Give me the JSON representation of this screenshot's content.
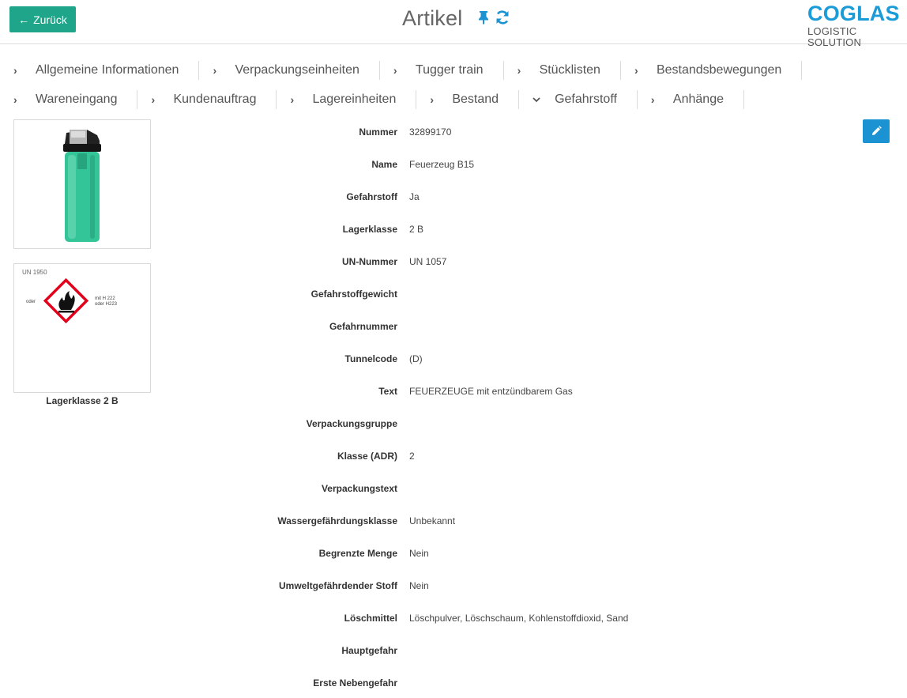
{
  "header": {
    "back_label": "Zurück",
    "title": "Artikel",
    "pin_icon": "pin-icon",
    "refresh_icon": "refresh-icon",
    "logo_main": "COGLAS",
    "logo_sub": "LOGISTIC SOLUTION"
  },
  "colors": {
    "primary": "#1fa589",
    "accent": "#1b93d3",
    "logo": "#1b9bd7"
  },
  "tabs": {
    "row1": [
      {
        "label": "Allgemeine Informationen",
        "state": "collapsed"
      },
      {
        "label": "Verpackungseinheiten",
        "state": "collapsed"
      },
      {
        "label": "Tugger train",
        "state": "collapsed"
      },
      {
        "label": "Stücklisten",
        "state": "collapsed"
      },
      {
        "label": "Bestandsbewegungen",
        "state": "collapsed"
      }
    ],
    "row2": [
      {
        "label": "Wareneingang",
        "state": "collapsed"
      },
      {
        "label": "Kundenauftrag",
        "state": "collapsed"
      },
      {
        "label": "Lagereinheiten",
        "state": "collapsed"
      },
      {
        "label": "Bestand",
        "state": "collapsed"
      },
      {
        "label": "Gefahrstoff",
        "state": "expanded"
      },
      {
        "label": "Anhänge",
        "state": "collapsed"
      }
    ]
  },
  "images": {
    "product_icon": "lighter-image",
    "ghs_un": "UN 1950",
    "ghs_oder": "oder",
    "ghs_note_1": "mit H 222",
    "ghs_note_2": "oder H223",
    "caption": "Lagerklasse 2 B"
  },
  "fields": [
    {
      "label": "Nummer",
      "value": "32899170"
    },
    {
      "label": "Name",
      "value": "Feuerzeug B15"
    },
    {
      "label": "Gefahrstoff",
      "value": "Ja"
    },
    {
      "label": "Lagerklasse",
      "value": "2 B"
    },
    {
      "label": "UN-Nummer",
      "value": "UN 1057"
    },
    {
      "label": "Gefahrstoffgewicht",
      "value": ""
    },
    {
      "label": "Gefahrnummer",
      "value": ""
    },
    {
      "label": "Tunnelcode",
      "value": "(D)"
    },
    {
      "label": "Text",
      "value": "FEUERZEUGE mit entzündbarem Gas"
    },
    {
      "label": "Verpackungsgruppe",
      "value": ""
    },
    {
      "label": "Klasse (ADR)",
      "value": "2"
    },
    {
      "label": "Verpackungstext",
      "value": ""
    },
    {
      "label": "Wassergefährdungsklasse",
      "value": "Unbekannt"
    },
    {
      "label": "Begrenzte Menge",
      "value": "Nein"
    },
    {
      "label": "Umweltgefährdender Stoff",
      "value": "Nein"
    },
    {
      "label": "Löschmittel",
      "value": "Löschpulver, Löschschaum, Kohlenstoffdioxid, Sand"
    },
    {
      "label": "Hauptgefahr",
      "value": ""
    },
    {
      "label": "Erste Nebengefahr",
      "value": ""
    }
  ]
}
